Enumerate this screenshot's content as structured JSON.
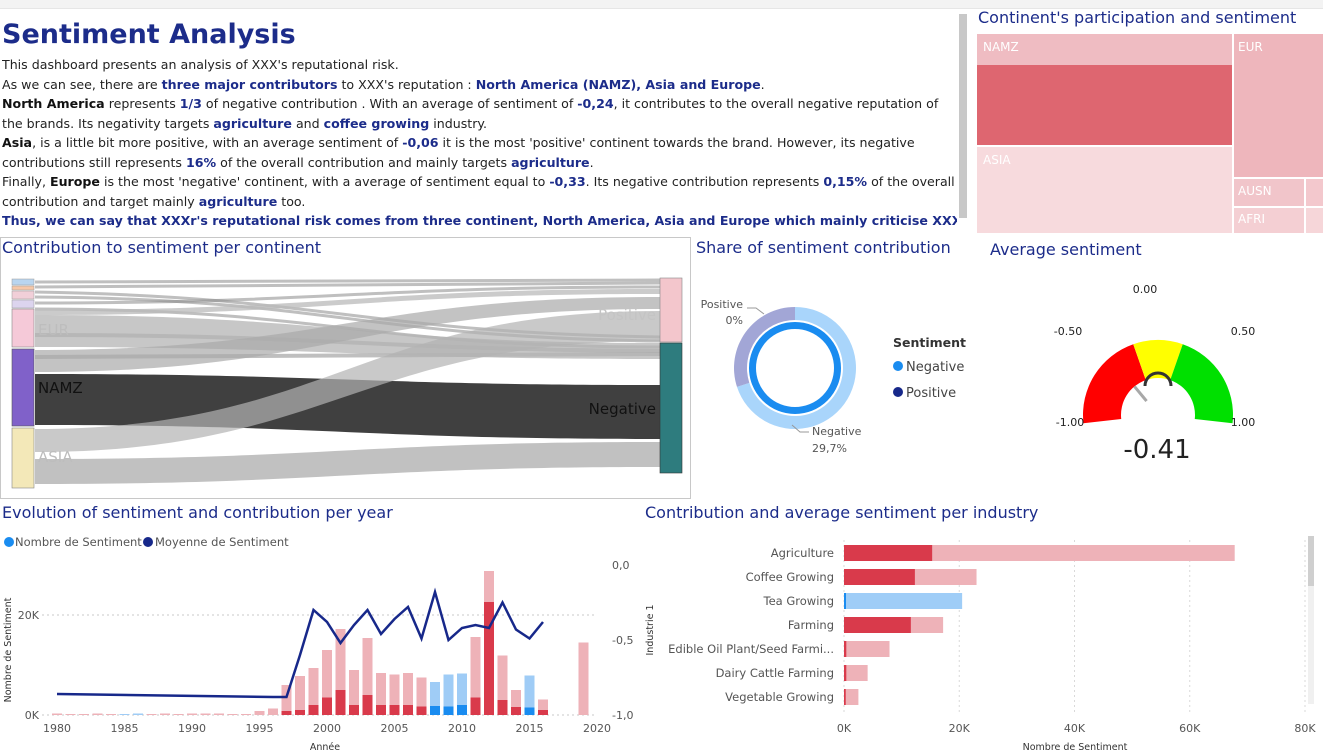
{
  "intro": {
    "title": "Sentiment Analysis",
    "line1": "This dashboard presents an analysis of XXX's reputational risk.",
    "line2": [
      {
        "t": "As we can see, there are ",
        "s": "n"
      },
      {
        "t": "three major contributors",
        "s": "h"
      },
      {
        "t": " to XXX's reputation : ",
        "s": "n"
      },
      {
        "t": "North America (NAMZ), Asia and Europe",
        "s": "h"
      },
      {
        "t": ".",
        "s": "n"
      }
    ],
    "line3": [
      {
        "t": "North America",
        "s": "b"
      },
      {
        "t": " represents ",
        "s": "n"
      },
      {
        "t": "1/3",
        "s": "h"
      },
      {
        "t": " of negative contribution . With an average of sentiment of ",
        "s": "n"
      },
      {
        "t": "-0,24",
        "s": "h"
      },
      {
        "t": ", it contributes to the overall negative reputation of the brands. Its negativity targets ",
        "s": "n"
      },
      {
        "t": "agriculture",
        "s": "h"
      },
      {
        "t": " and ",
        "s": "n"
      },
      {
        "t": "coffee growing",
        "s": "h"
      },
      {
        "t": " industry.",
        "s": "n"
      }
    ],
    "line4": [
      {
        "t": "Asia",
        "s": "b"
      },
      {
        "t": ", is a little bit more positive, with an average sentiment of ",
        "s": "n"
      },
      {
        "t": "-0,06",
        "s": "h"
      },
      {
        "t": " it is the most 'positive' continent towards the brand. However, its negative contributions still represents ",
        "s": "n"
      },
      {
        "t": "16%",
        "s": "h"
      },
      {
        "t": " of the overall contribution and mainly targets ",
        "s": "n"
      },
      {
        "t": "agriculture",
        "s": "h"
      },
      {
        "t": ".",
        "s": "n"
      }
    ],
    "line5": [
      {
        "t": "Finally, ",
        "s": "n"
      },
      {
        "t": "Europe",
        "s": "b"
      },
      {
        "t": " is the most 'negative' continent, with a average of sentiment equal to ",
        "s": "n"
      },
      {
        "t": "-0,33",
        "s": "h"
      },
      {
        "t": ". Its negative contribution represents ",
        "s": "n"
      },
      {
        "t": "0,15%",
        "s": "h"
      },
      {
        "t": " of the overall contribution and target mainly ",
        "s": "n"
      },
      {
        "t": "agriculture",
        "s": "h"
      },
      {
        "t": " too.",
        "s": "n"
      }
    ],
    "line6": "Thus, we can say that XXXr's reputational risk comes from three continent, North America, Asia and Europe which mainly criticise XXX's"
  },
  "treemap": {
    "title": "Continent's participation and sentiment",
    "tiles": [
      {
        "label": "NAMZ",
        "color": "#efbcc2",
        "strong": "#de6670"
      },
      {
        "label": "EUR",
        "color": "#eeb6bc"
      },
      {
        "label": "ASIA",
        "color": "#f7dadd"
      },
      {
        "label": "AUSN",
        "color": "#f1c5ca"
      },
      {
        "label": "AFRI",
        "color": "#f4cfd3"
      }
    ]
  },
  "sankey": {
    "title": "Contribution to sentiment per continent",
    "left_nodes": [
      {
        "label": "EUR",
        "color": "#f5c9d8"
      },
      {
        "label": "NAMZ",
        "color": "#8061c9"
      },
      {
        "label": "ASIA",
        "color": "#f3e8b8"
      }
    ],
    "right_nodes": [
      {
        "label": "Positive",
        "color": "#f3c6cc"
      },
      {
        "label": "Negative",
        "color": "#2e7c7e"
      }
    ]
  },
  "donut": {
    "title": "Share of sentiment contribution",
    "legend_title": "Sentiment",
    "legend": [
      {
        "label": "Negative",
        "color": "#1a8cf0"
      },
      {
        "label": "Positive",
        "color": "#17288a"
      }
    ],
    "label_positive": "Positive",
    "label_positive_pct": "0%",
    "label_negative": "Negative",
    "label_negative_pct": "29,7%",
    "outer_ring": [
      {
        "name": "Negative",
        "share": 0.7,
        "color": "#a9d5fb"
      },
      {
        "name": "Positive",
        "share": 0.3,
        "color": "#a2a6d6"
      }
    ],
    "inner_ring_color": "#1a8cf0"
  },
  "gauge": {
    "title": "Average sentiment",
    "value": -0.41,
    "value_label": "-0.41",
    "ticks": [
      "-1.00",
      "-0.50",
      "0.00",
      "0.50",
      "1.00"
    ],
    "bands": [
      {
        "from": -1.0,
        "to": -0.2,
        "color": "#ff0000"
      },
      {
        "from": -0.2,
        "to": 0.2,
        "color": "#ffff00"
      },
      {
        "from": 0.2,
        "to": 1.0,
        "color": "#00e000"
      }
    ]
  },
  "evolution": {
    "title": "Evolution of sentiment and contribution per year",
    "legend": [
      {
        "label": "Nombre de Sentiment",
        "color": "#1a8cf0"
      },
      {
        "label": "Moyenne de Sentiment",
        "color": "#17288a"
      }
    ],
    "ylabel_left": "Nombre de Sentiment",
    "xlabel": "Année",
    "yticks_left": [
      "0K",
      "20K"
    ],
    "yticks_right": [
      "0,0",
      "-0,5",
      "-1,0"
    ],
    "xticks": [
      "1980",
      "1985",
      "1990",
      "1995",
      "2000",
      "2005",
      "2010",
      "2015",
      "2020"
    ]
  },
  "industry": {
    "title": "Contribution and average sentiment per industry",
    "ylabel": "Industrie 1",
    "xlabel": "Nombre de Sentiment",
    "xticks": [
      "0K",
      "20K",
      "40K",
      "60K",
      "80K"
    ]
  },
  "chart_data": [
    {
      "type": "bar",
      "title": "Evolution of sentiment and contribution per year",
      "xlabel": "Année",
      "ylabel": "Nombre de Sentiment",
      "xlim": [
        1980,
        2020
      ],
      "ylim": [
        0,
        30000
      ],
      "y2lim": [
        -1.0,
        0.0
      ],
      "series": [
        {
          "name": "Nombre de Sentiment",
          "kind": "stacked-bar",
          "points": [
            [
              1980,
              300,
              0,
              "neg"
            ],
            [
              1981,
              200,
              0,
              "neg"
            ],
            [
              1982,
              200,
              0,
              "neg"
            ],
            [
              1983,
              300,
              0,
              "neg"
            ],
            [
              1984,
              200,
              0,
              "neg"
            ],
            [
              1985,
              200,
              0,
              "pos"
            ],
            [
              1986,
              300,
              0,
              "pos"
            ],
            [
              1987,
              200,
              0,
              "neg"
            ],
            [
              1988,
              300,
              0,
              "neg"
            ],
            [
              1989,
              200,
              0,
              "neg"
            ],
            [
              1990,
              300,
              0,
              "neg"
            ],
            [
              1991,
              300,
              0,
              "neg"
            ],
            [
              1992,
              300,
              0,
              "neg"
            ],
            [
              1993,
              200,
              0,
              "neg"
            ],
            [
              1994,
              200,
              0,
              "neg"
            ],
            [
              1995,
              800,
              0,
              "neg"
            ],
            [
              1996,
              1300,
              0,
              "neg"
            ],
            [
              1997,
              6000,
              800,
              "neg"
            ],
            [
              1998,
              7800,
              1000,
              "neg"
            ],
            [
              1999,
              9400,
              2000,
              "neg"
            ],
            [
              2000,
              13000,
              3500,
              "neg"
            ],
            [
              2001,
              17200,
              5000,
              "neg"
            ],
            [
              2002,
              9000,
              2000,
              "neg"
            ],
            [
              2003,
              15400,
              4000,
              "neg"
            ],
            [
              2004,
              8400,
              2000,
              "neg"
            ],
            [
              2005,
              8100,
              2000,
              "neg"
            ],
            [
              2006,
              8400,
              2000,
              "neg"
            ],
            [
              2007,
              7500,
              1700,
              "neg"
            ],
            [
              2008,
              6600,
              1800,
              "pos"
            ],
            [
              2009,
              8100,
              1700,
              "pos"
            ],
            [
              2010,
              8300,
              2000,
              "pos"
            ],
            [
              2011,
              15600,
              3500,
              "neg"
            ],
            [
              2012,
              28800,
              22600,
              "neg"
            ],
            [
              2013,
              11900,
              3000,
              "neg"
            ],
            [
              2014,
              5000,
              1600,
              "neg"
            ],
            [
              2015,
              7900,
              1500,
              "pos"
            ],
            [
              2016,
              3100,
              1000,
              "neg"
            ],
            [
              2017,
              0,
              0,
              "neg"
            ],
            [
              2018,
              0,
              0,
              "neg"
            ],
            [
              2019,
              14500,
              0,
              "neg"
            ]
          ]
        },
        {
          "name": "Moyenne de Sentiment",
          "kind": "line",
          "x": [
            1980,
            1996,
            1997,
            1998,
            1999,
            2000,
            2001,
            2002,
            2003,
            2004,
            2005,
            2006,
            2007,
            2008,
            2009,
            2010,
            2011,
            2012,
            2013,
            2014,
            2015,
            2016
          ],
          "y": [
            -0.86,
            -0.88,
            -0.88,
            -0.6,
            -0.3,
            -0.38,
            -0.52,
            -0.4,
            -0.3,
            -0.46,
            -0.36,
            -0.28,
            -0.49,
            -0.18,
            -0.5,
            -0.42,
            -0.4,
            -0.42,
            -0.25,
            -0.43,
            -0.49,
            -0.38
          ]
        }
      ]
    },
    {
      "type": "bar",
      "orientation": "horizontal",
      "title": "Contribution and average sentiment per industry",
      "xlabel": "Nombre de Sentiment",
      "ylabel": "Industrie 1",
      "xlim": [
        0,
        80000
      ],
      "categories": [
        "Agriculture",
        "Coffee Growing",
        "Tea Growing",
        "Farming",
        "Edible Oil Plant/Seed Farmi...",
        "Dairy Cattle Farming",
        "Vegetable Growing"
      ],
      "series": [
        {
          "name": "Nombre de Sentiment",
          "values": [
            67800,
            23000,
            20500,
            17200,
            7900,
            4100,
            2500
          ]
        },
        {
          "name": "Negative part",
          "values": [
            15300,
            12300,
            0,
            11600,
            400,
            400,
            300
          ]
        }
      ]
    },
    {
      "type": "pie",
      "title": "Share of sentiment contribution",
      "categories": [
        "Positive",
        "Negative"
      ],
      "values": [
        0,
        29.7
      ]
    }
  ]
}
